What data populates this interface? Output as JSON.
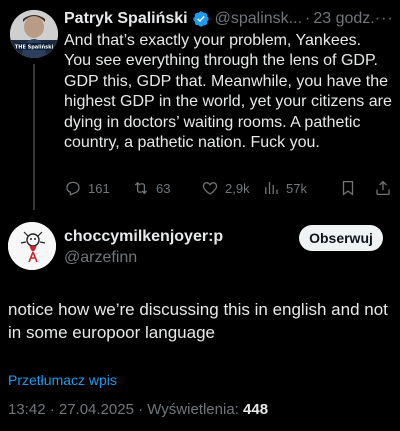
{
  "parent_tweet": {
    "author_name": "Patryk Spaliński",
    "author_handle": "@spalinsk...",
    "separator": "·",
    "time": "23 godz.",
    "more": "···",
    "avatar_caption": "THE Spaliński",
    "text": "And that’s exactly your problem, Yankees. You see everything through the lens of GDP. GDP this, GDP that. Meanwhile, you have the highest GDP in the world, yet your citizens are dying in doctors’ waiting rooms. A pathetic country, a pathetic nation. Fuck you.",
    "stats": {
      "replies": "161",
      "reposts": "63",
      "likes": "2,9k",
      "views": "57k"
    }
  },
  "main_tweet": {
    "author_name": "choccymilkenjoyer:p",
    "author_handle": "@arzefinn",
    "follow_label": "Obserwuj",
    "text": "notice how we’re discussing this in english and not in some europoor language",
    "translate_label": "Przetłumacz wpis",
    "timestamp": "13:42 · 27.04.2025 · Wyświetlenia:",
    "views": "448"
  },
  "colors": {
    "background": "#000000",
    "text": "#e7e9ea",
    "muted": "#71767b",
    "link": "#1d9bf0",
    "verified": "#1d9bf0"
  },
  "icons": [
    "verified-badge-icon",
    "more-icon",
    "reply-icon",
    "repost-icon",
    "like-icon",
    "views-icon",
    "bookmark-icon",
    "share-icon"
  ]
}
